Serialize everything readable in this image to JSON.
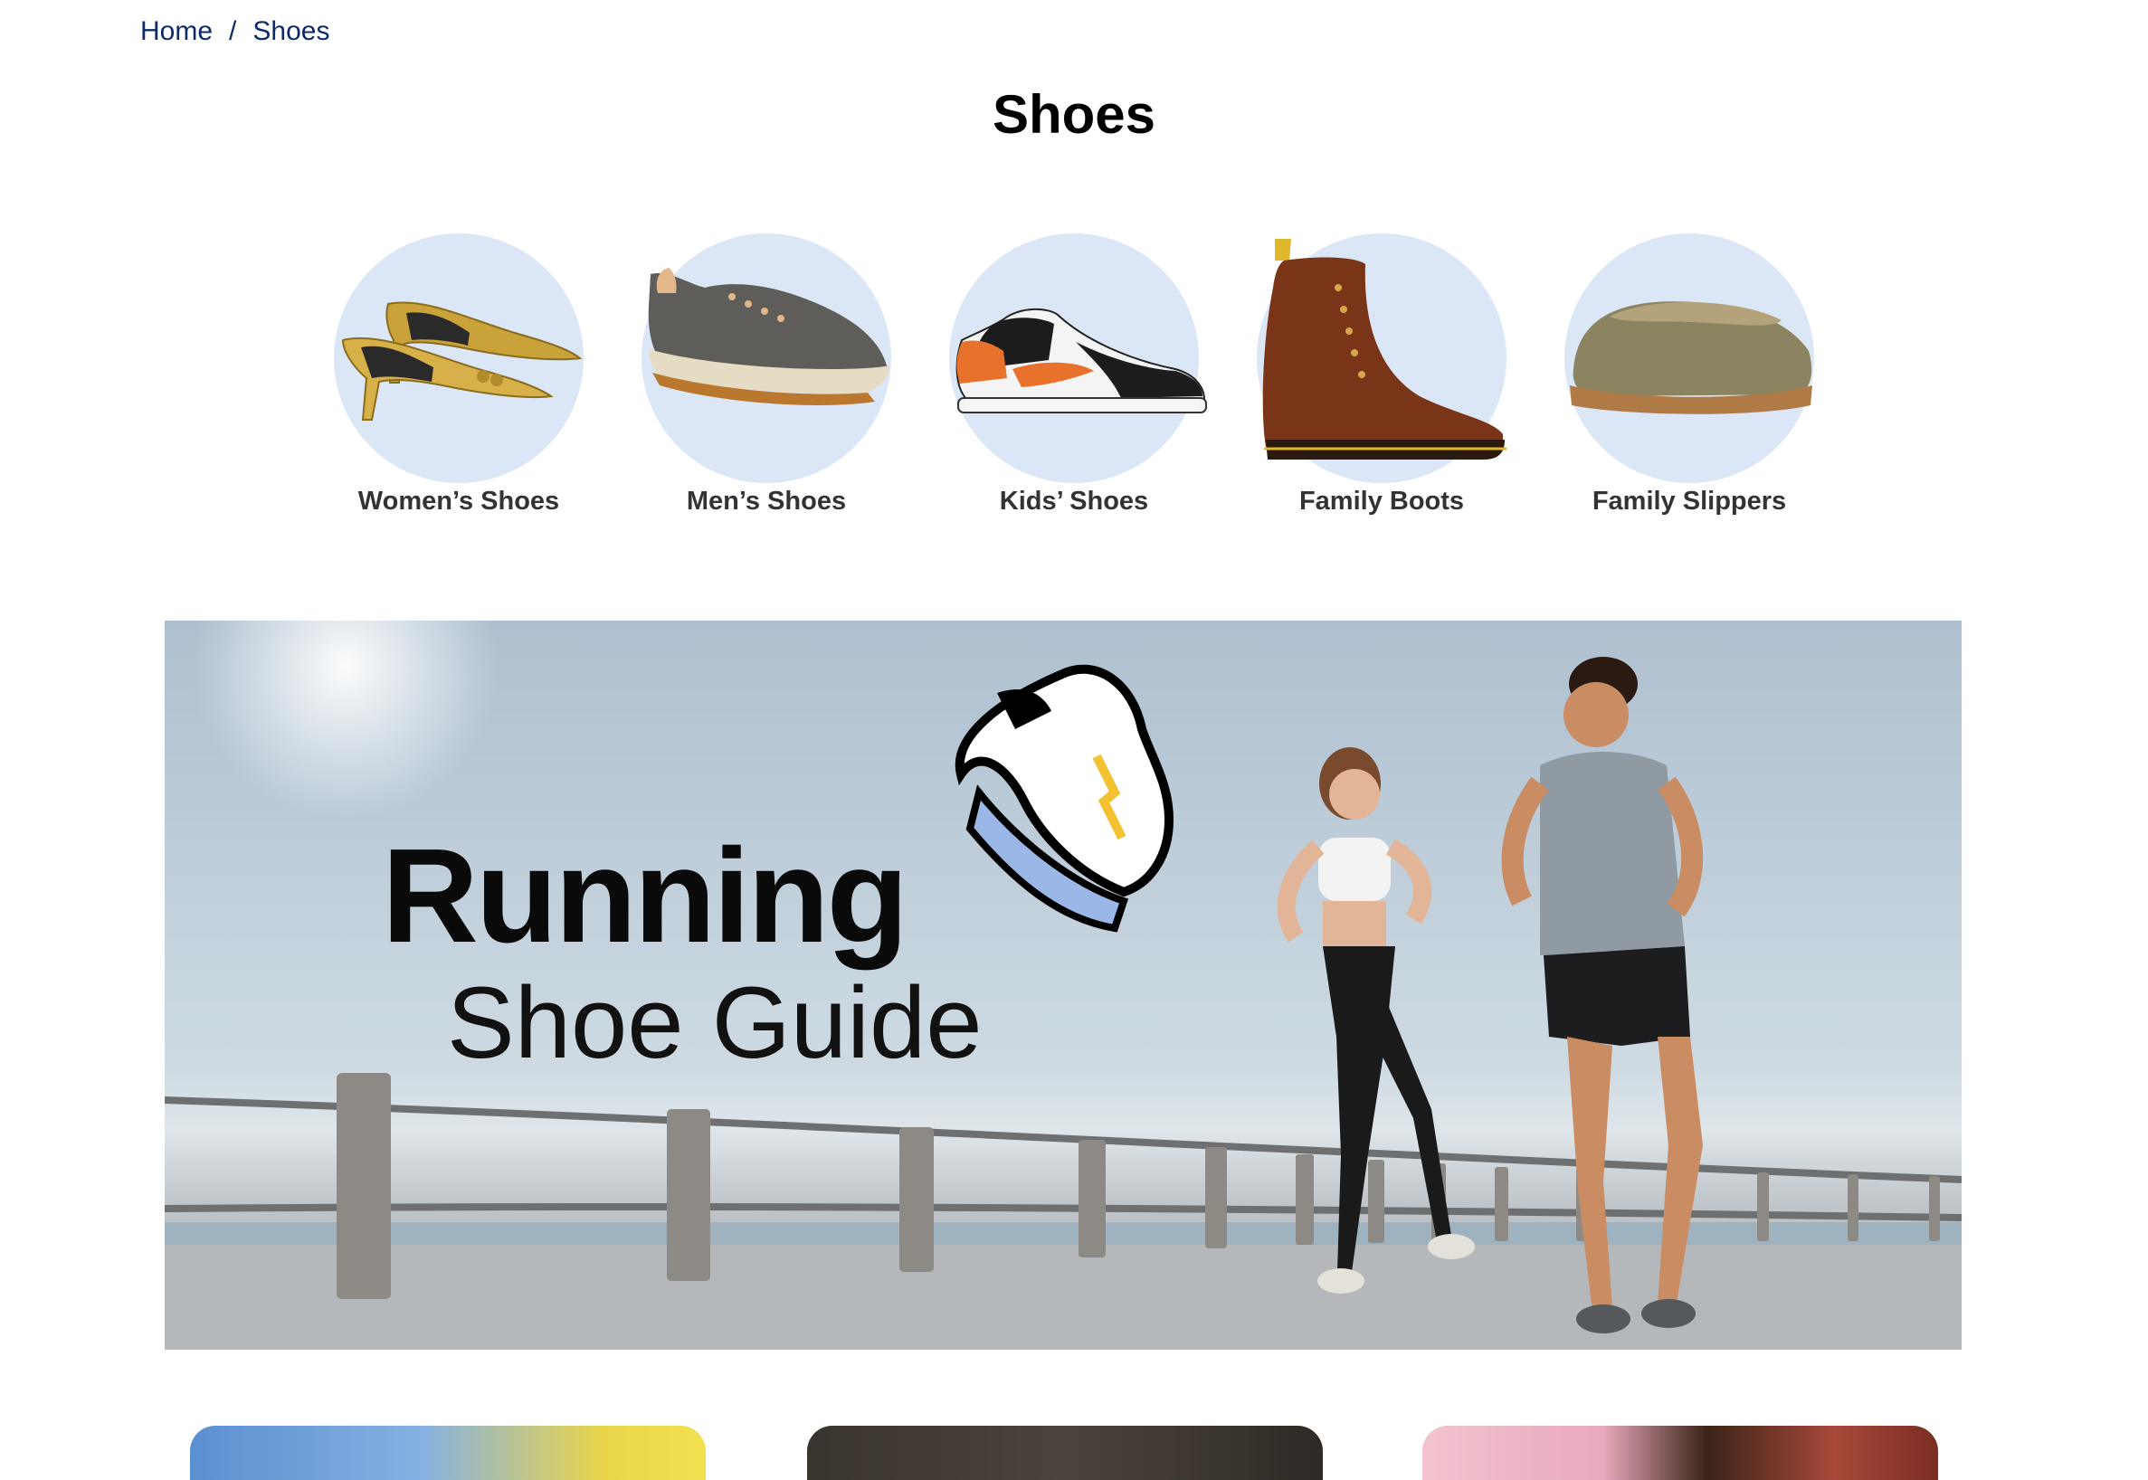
{
  "breadcrumb": {
    "items": [
      "Home",
      "Shoes"
    ],
    "separator": "/"
  },
  "page_title": "Shoes",
  "categories": [
    {
      "label": "Women’s Shoes",
      "icon": "gold-kitten-heel-mule-icon"
    },
    {
      "label": "Men’s Shoes",
      "icon": "gray-sneaker-icon"
    },
    {
      "label": "Kids’ Shoes",
      "icon": "orange-high-top-sneaker-icon"
    },
    {
      "label": "Family Boots",
      "icon": "brown-lace-up-boot-icon"
    },
    {
      "label": "Family Slippers",
      "icon": "tan-clog-slipper-icon"
    }
  ],
  "hero": {
    "title_line1": "Running",
    "title_line2": "Shoe Guide"
  },
  "colors": {
    "link": "#0d2a6b",
    "circle_bg": "#dbe7f6",
    "label": "#333333"
  }
}
